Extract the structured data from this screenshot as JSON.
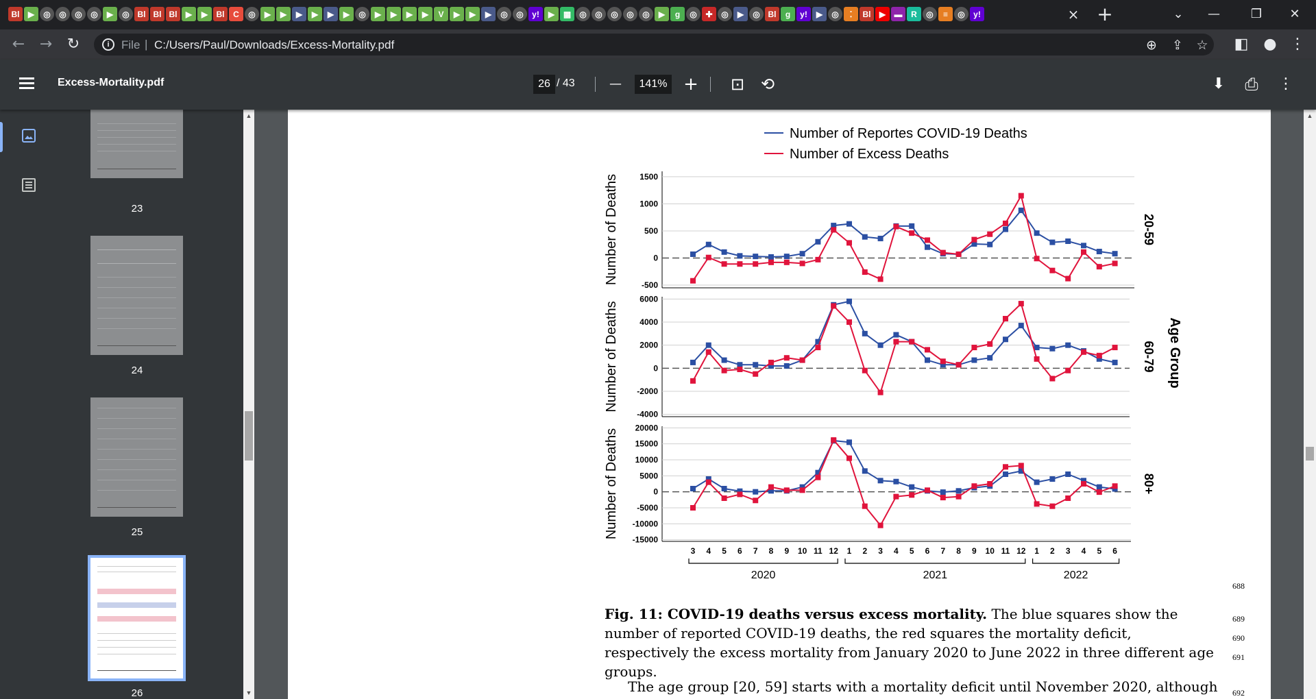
{
  "browser": {
    "tab_close": "×",
    "new_tab": "+",
    "favicons": [
      {
        "t": "Bl",
        "c": "#c0392b"
      },
      {
        "t": "▶",
        "c": "#6ab04c"
      },
      {
        "t": "◎",
        "c": "#555"
      },
      {
        "t": "◎",
        "c": "#555"
      },
      {
        "t": "◎",
        "c": "#555"
      },
      {
        "t": "◎",
        "c": "#555"
      },
      {
        "t": "▶",
        "c": "#6ab04c"
      },
      {
        "t": "◎",
        "c": "#555"
      },
      {
        "t": "Bl",
        "c": "#c0392b"
      },
      {
        "t": "Bl",
        "c": "#c0392b"
      },
      {
        "t": "Bl",
        "c": "#c0392b"
      },
      {
        "t": "▶",
        "c": "#6ab04c"
      },
      {
        "t": "▶",
        "c": "#6ab04c"
      },
      {
        "t": "Bl",
        "c": "#c0392b"
      },
      {
        "t": "C",
        "c": "#e74c3c"
      },
      {
        "t": "◎",
        "c": "#555"
      },
      {
        "t": "▶",
        "c": "#6ab04c"
      },
      {
        "t": "▶",
        "c": "#6ab04c"
      },
      {
        "t": "▶",
        "c": "#4a5a8a"
      },
      {
        "t": "▶",
        "c": "#6ab04c"
      },
      {
        "t": "▶",
        "c": "#4a5a8a"
      },
      {
        "t": "▶",
        "c": "#6ab04c"
      },
      {
        "t": "◎",
        "c": "#555"
      },
      {
        "t": "▶",
        "c": "#6ab04c"
      },
      {
        "t": "▶",
        "c": "#6ab04c"
      },
      {
        "t": "▶",
        "c": "#6ab04c"
      },
      {
        "t": "▶",
        "c": "#6ab04c"
      },
      {
        "t": "V",
        "c": "#6ab04c"
      },
      {
        "t": "▶",
        "c": "#6ab04c"
      },
      {
        "t": "▶",
        "c": "#6ab04c"
      },
      {
        "t": "▶",
        "c": "#4a5a8a"
      },
      {
        "t": "◎",
        "c": "#555"
      },
      {
        "t": "◎",
        "c": "#555"
      },
      {
        "t": "y!",
        "c": "#6001d2"
      },
      {
        "t": "▶",
        "c": "#6ab04c"
      },
      {
        "t": "▦",
        "c": "#3b6"
      },
      {
        "t": "◎",
        "c": "#555"
      },
      {
        "t": "◎",
        "c": "#555"
      },
      {
        "t": "◎",
        "c": "#555"
      },
      {
        "t": "◎",
        "c": "#555"
      },
      {
        "t": "◎",
        "c": "#555"
      },
      {
        "t": "▶",
        "c": "#6ab04c"
      },
      {
        "t": "g",
        "c": "#4caf50"
      },
      {
        "t": "◎",
        "c": "#555"
      },
      {
        "t": "✚",
        "c": "#c62828"
      },
      {
        "t": "◎",
        "c": "#555"
      },
      {
        "t": "▶",
        "c": "#4a5a8a"
      },
      {
        "t": "◎",
        "c": "#555"
      },
      {
        "t": "Bl",
        "c": "#c0392b"
      },
      {
        "t": "g",
        "c": "#4caf50"
      },
      {
        "t": "y!",
        "c": "#6001d2"
      },
      {
        "t": "▶",
        "c": "#4a5a8a"
      },
      {
        "t": "◎",
        "c": "#555"
      },
      {
        "t": "⁚",
        "c": "#e67e22"
      },
      {
        "t": "Bl",
        "c": "#c0392b"
      },
      {
        "t": "▶",
        "c": "#e00"
      },
      {
        "t": "▬",
        "c": "#8e24aa"
      },
      {
        "t": "R",
        "c": "#1abc9c"
      },
      {
        "t": "◎",
        "c": "#555"
      },
      {
        "t": "≡",
        "c": "#e67e22"
      },
      {
        "t": "◎",
        "c": "#555"
      },
      {
        "t": "y!",
        "c": "#6001d2"
      }
    ],
    "window_controls": {
      "chevron": "⌄",
      "minimize": "—",
      "restore": "❐",
      "close": "✕"
    }
  },
  "address_bar": {
    "back": "←",
    "forward": "→",
    "reload": "↻",
    "info": "i",
    "scheme": "File",
    "separator": "|",
    "url": "C:/Users/Paul/Downloads/Excess-Mortality.pdf",
    "zoom_icon": "⊕",
    "share_icon": "⇪",
    "star_icon": "☆",
    "sidepanel_icon": "◧",
    "profile_icon": "●",
    "kebab": "⋮"
  },
  "pdf_toolbar": {
    "menu": "≡",
    "title": "Excess-Mortality.pdf",
    "current_page": "26",
    "total_pages": "/ 43",
    "zoom_out": "—",
    "zoom": "141%",
    "zoom_in": "+",
    "fit_icon": "⊡",
    "rotate_icon": "⟲",
    "download_icon": "⬇",
    "print_icon": "⎙",
    "more_icon": "⋮"
  },
  "sidebar": {
    "thumbnails": [
      {
        "page": "23"
      },
      {
        "page": "24"
      },
      {
        "page": "25"
      },
      {
        "page": "26"
      }
    ]
  },
  "figure": {
    "legend": [
      {
        "label": "Number of Reportes COVID-19 Deaths",
        "color": "#2b4fa3"
      },
      {
        "label": "Number of Excess Deaths",
        "color": "#e0143c"
      }
    ],
    "ylabel": "Number of Deaths",
    "group_label": "Age Group",
    "year_labels": [
      "2020",
      "2021",
      "2022"
    ],
    "month_ticks": [
      "3",
      "4",
      "5",
      "6",
      "7",
      "8",
      "9",
      "10",
      "11",
      "12",
      "1",
      "2",
      "3",
      "4",
      "5",
      "6",
      "7",
      "8",
      "9",
      "10",
      "11",
      "12",
      "1",
      "2",
      "3",
      "4",
      "5",
      "6"
    ]
  },
  "chart_data": [
    {
      "type": "line",
      "panel": "20-59",
      "ylabel": "Number of Deaths",
      "yticks": [
        -500,
        0,
        500,
        1000,
        1500
      ],
      "ylim": [
        -550,
        1600
      ],
      "x": [
        "2020-03",
        "2020-04",
        "2020-05",
        "2020-06",
        "2020-07",
        "2020-08",
        "2020-09",
        "2020-10",
        "2020-11",
        "2020-12",
        "2021-01",
        "2021-02",
        "2021-03",
        "2021-04",
        "2021-05",
        "2021-06",
        "2021-07",
        "2021-08",
        "2021-09",
        "2021-10",
        "2021-11",
        "2021-12",
        "2022-01",
        "2022-02",
        "2022-03",
        "2022-04",
        "2022-05",
        "2022-06"
      ],
      "series": [
        {
          "name": "Number of Reportes COVID-19 Deaths",
          "color": "#2b4fa3",
          "values": [
            70,
            250,
            110,
            40,
            30,
            20,
            30,
            80,
            300,
            600,
            630,
            390,
            360,
            590,
            590,
            200,
            80,
            70,
            260,
            250,
            530,
            880,
            460,
            290,
            310,
            230,
            120,
            80
          ]
        },
        {
          "name": "Number of Excess Deaths",
          "color": "#e0143c",
          "values": [
            -420,
            10,
            -110,
            -110,
            -110,
            -80,
            -80,
            -100,
            -30,
            520,
            280,
            -260,
            -390,
            580,
            460,
            330,
            100,
            70,
            340,
            440,
            640,
            1150,
            -10,
            -230,
            -380,
            110,
            -160,
            -100
          ]
        }
      ]
    },
    {
      "type": "line",
      "panel": "60-79",
      "ylabel": "Number of Deaths",
      "yticks": [
        -4000,
        -2000,
        0,
        2000,
        4000,
        6000
      ],
      "ylim": [
        -4200,
        6200
      ],
      "x": [
        "2020-03",
        "2020-04",
        "2020-05",
        "2020-06",
        "2020-07",
        "2020-08",
        "2020-09",
        "2020-10",
        "2020-11",
        "2020-12",
        "2021-01",
        "2021-02",
        "2021-03",
        "2021-04",
        "2021-05",
        "2021-06",
        "2021-07",
        "2021-08",
        "2021-09",
        "2021-10",
        "2021-11",
        "2021-12",
        "2022-01",
        "2022-02",
        "2022-03",
        "2022-04",
        "2022-05",
        "2022-06"
      ],
      "series": [
        {
          "name": "Number of Reportes COVID-19 Deaths",
          "color": "#2b4fa3",
          "values": [
            500,
            2000,
            700,
            300,
            300,
            200,
            200,
            700,
            2300,
            5500,
            5800,
            3000,
            2000,
            2900,
            2300,
            700,
            300,
            300,
            700,
            900,
            2500,
            3700,
            1800,
            1700,
            2000,
            1500,
            800,
            500
          ]
        },
        {
          "name": "Number of Excess Deaths",
          "color": "#e0143c",
          "values": [
            -1100,
            1400,
            -200,
            -100,
            -500,
            500,
            900,
            700,
            1800,
            5400,
            4000,
            -200,
            -2100,
            2300,
            2300,
            1600,
            600,
            300,
            1800,
            2100,
            4300,
            5600,
            800,
            -900,
            -200,
            1400,
            1100,
            1800
          ]
        }
      ]
    },
    {
      "type": "line",
      "panel": "80+",
      "ylabel": "Number of Deaths",
      "yticks": [
        -15000,
        -10000,
        -5000,
        0,
        5000,
        10000,
        15000,
        20000
      ],
      "ylim": [
        -15500,
        20500
      ],
      "x": [
        "2020-03",
        "2020-04",
        "2020-05",
        "2020-06",
        "2020-07",
        "2020-08",
        "2020-09",
        "2020-10",
        "2020-11",
        "2020-12",
        "2021-01",
        "2021-02",
        "2021-03",
        "2021-04",
        "2021-05",
        "2021-06",
        "2021-07",
        "2021-08",
        "2021-09",
        "2021-10",
        "2021-11",
        "2021-12",
        "2022-01",
        "2022-02",
        "2022-03",
        "2022-04",
        "2022-05",
        "2022-06"
      ],
      "series": [
        {
          "name": "Number of Reportes COVID-19 Deaths",
          "color": "#2b4fa3",
          "values": [
            1000,
            4000,
            1000,
            200,
            0,
            300,
            300,
            1500,
            6000,
            16000,
            15500,
            6500,
            3500,
            3200,
            1500,
            300,
            -100,
            300,
            1300,
            1800,
            5500,
            6500,
            3000,
            4000,
            5500,
            3500,
            1500,
            900
          ]
        },
        {
          "name": "Number of Excess Deaths",
          "color": "#e0143c",
          "values": [
            -5000,
            3000,
            -2000,
            -800,
            -2700,
            1500,
            500,
            500,
            4500,
            16200,
            10500,
            -4500,
            -10500,
            -1500,
            -1000,
            500,
            -1800,
            -1500,
            1800,
            2500,
            7800,
            8200,
            -3800,
            -4500,
            -2000,
            2500,
            -100,
            1800
          ]
        }
      ]
    }
  ],
  "document": {
    "line_numbers": [
      "688",
      "689",
      "690",
      "691",
      "692"
    ],
    "caption_bold": "Fig. 11: COVID-19 deaths versus excess mortality.",
    "caption_rest": " The blue squares show the number of reported COVID-19 deaths, the red squares the mortality deficit, respectively the excess mortality from January 2020 to June 2022 in three different age groups.",
    "paragraph": "The age group [20, 59] starts with a mortality deficit until November 2020, although"
  }
}
